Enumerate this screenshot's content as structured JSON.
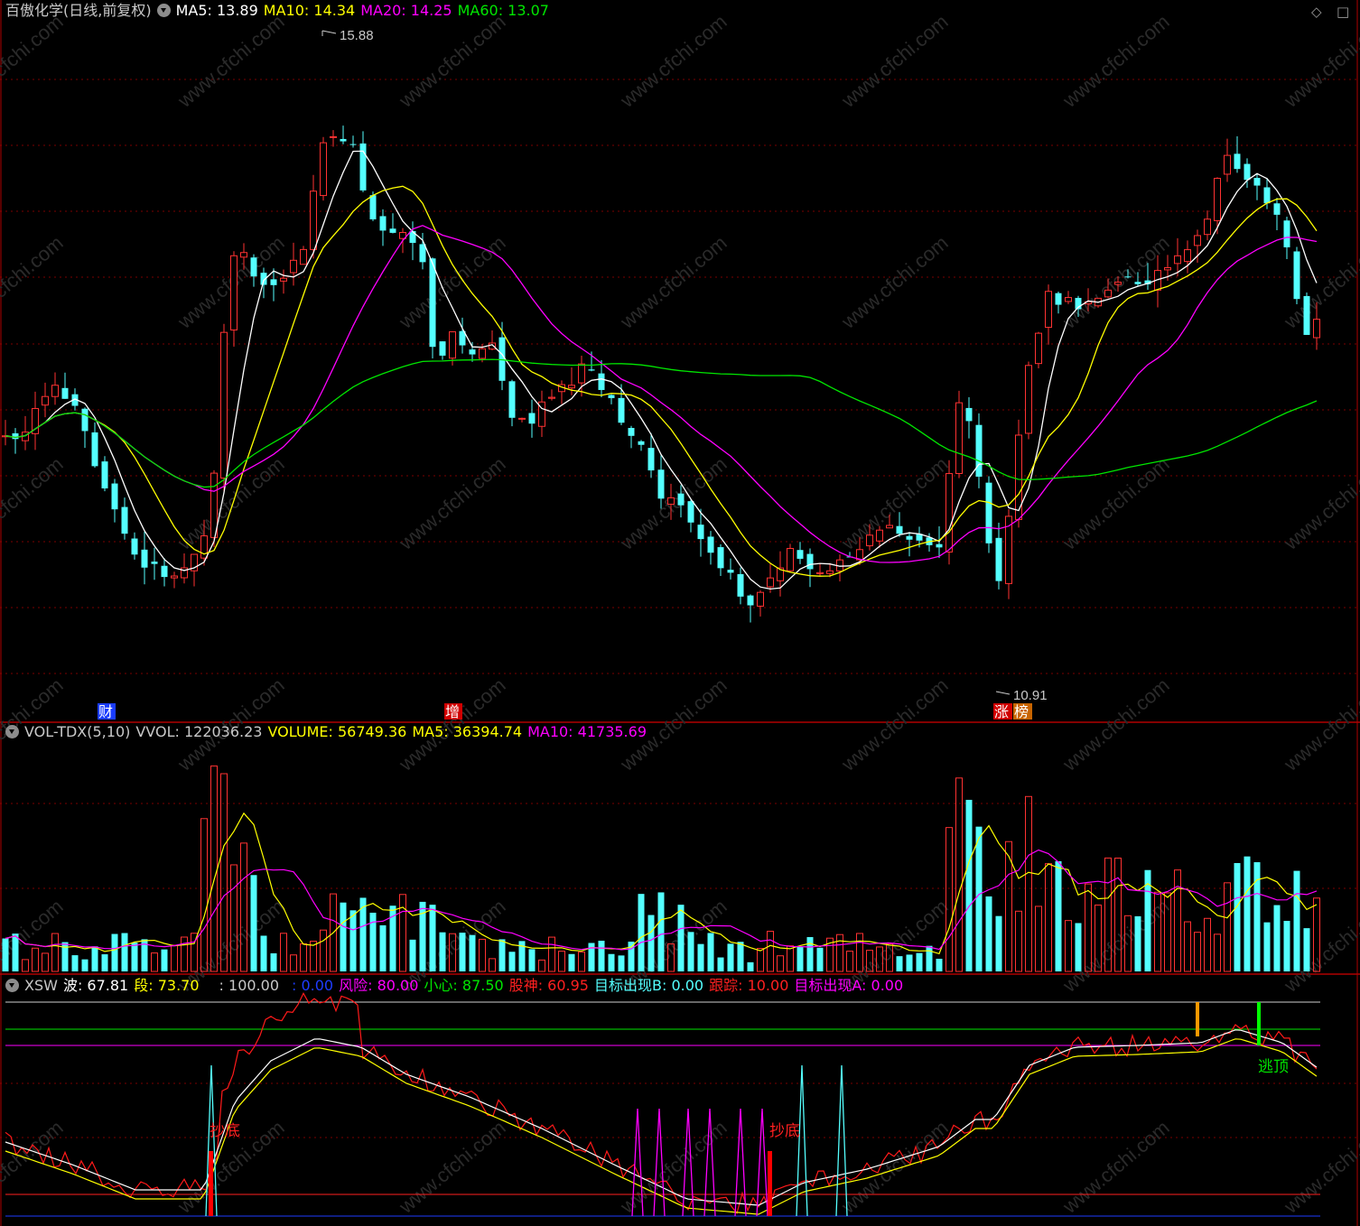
{
  "header": {
    "title": "百傲化学(日线,前复权)",
    "ma5": "MA5: 13.89",
    "ma10": "MA10: 14.34",
    "ma20": "MA20: 14.25",
    "ma60": "MA60: 13.07",
    "top_icons": [
      "◇",
      "□"
    ]
  },
  "volume_header": {
    "name": "VOL-TDX(5,10)",
    "vvol": "VVOL: 122036.23",
    "volume": "VOLUME: 56749.36",
    "ma5": "MA5: 36394.74",
    "ma10": "MA10: 41735.69"
  },
  "xsw_header": {
    "name": "XSW",
    "bo_label": "波: 67.81",
    "duan_label": "段: 73.70",
    "v100": ": 100.00",
    "v0": ": 0.00",
    "fengxian": "风险: 80.00",
    "xiaoxin": "小心: 87.50",
    "gushen": "股神: 60.95",
    "mubiao_b": "目标出现B: 0.00",
    "genzong": "跟踪: 10.00",
    "mubiao_a": "目标出现A: 0.00"
  },
  "colors": {
    "up": "#ff3232",
    "down": "#54ffff",
    "ma5": "#ffffff",
    "ma10": "#ffff00",
    "ma20": "#ff00ff",
    "ma60": "#00e600",
    "grid": "#7a0000",
    "divider": "#b00000"
  },
  "chart_data": [
    {
      "type": "candlestick",
      "title": "百傲化学(日线,前复权)",
      "series": [
        {
          "name": "MA5",
          "value": 13.89
        },
        {
          "name": "MA10",
          "value": 14.34
        },
        {
          "name": "MA20",
          "value": 14.25
        },
        {
          "name": "MA60",
          "value": 13.07
        }
      ],
      "annotations": [
        {
          "text": "15.88",
          "kind": "high"
        },
        {
          "text": "10.91",
          "kind": "low"
        }
      ],
      "markers": [
        "财",
        "增",
        "涨",
        "榜"
      ],
      "grid": true
    },
    {
      "type": "bar",
      "title": "VOL-TDX(5,10)",
      "series": [
        {
          "name": "VVOL",
          "value": 122036.23
        },
        {
          "name": "VOLUME",
          "value": 56749.36
        },
        {
          "name": "MA5",
          "value": 36394.74
        },
        {
          "name": "MA10",
          "value": 41735.69
        }
      ]
    },
    {
      "type": "line",
      "title": "XSW",
      "series": [
        {
          "name": "波",
          "value": 67.81
        },
        {
          "name": "段",
          "value": 73.7
        },
        {
          "name": "风险",
          "value": 80.0
        },
        {
          "name": "小心",
          "value": 87.5
        },
        {
          "name": "股神",
          "value": 60.95
        },
        {
          "name": "目标出现B",
          "value": 0.0
        },
        {
          "name": "跟踪",
          "value": 10.0
        },
        {
          "name": "目标出现A",
          "value": 0.0
        }
      ],
      "annotations": [
        {
          "text": "抄底"
        },
        {
          "text": "抄底"
        },
        {
          "text": "逃顶"
        }
      ]
    }
  ]
}
